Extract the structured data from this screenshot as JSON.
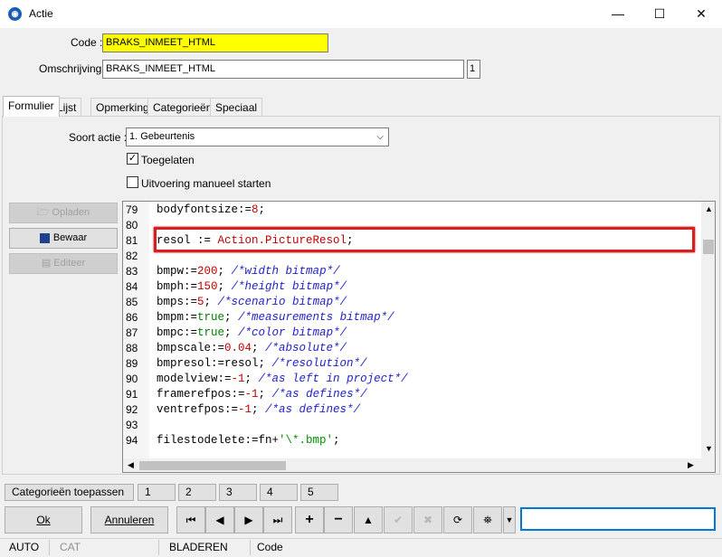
{
  "window": {
    "title": "Actie",
    "app_icon": "app-logo-icon",
    "minimize_icon": "—",
    "maximize_icon": "☐",
    "close_icon": "✕"
  },
  "form": {
    "code_label": "Code :",
    "code_value": "BRAKS_INMEET_HTML",
    "code_bg": "#ffff00",
    "omschrijving_label": "Omschrijving :",
    "omschrijving_value": "BRAKS_INMEET_HTML",
    "omschrijving_suffix": "1"
  },
  "tabs": [
    "Formulier",
    "Lijst",
    "Opmerking",
    "Categorieën",
    "Speciaal"
  ],
  "formulier": {
    "soort_label": "Soort actie :",
    "soort_value": "1.  Gebeurtenis",
    "toegelaten_label": "Toegelaten",
    "toegelaten_checked": true,
    "uitvoering_label": "Uitvoering manueel starten",
    "uitvoering_checked": false
  },
  "side_buttons": {
    "opladen": "Opladen",
    "bewaar": "Bewaar",
    "editeer": "Editeer"
  },
  "code_lines": [
    {
      "n": "79",
      "parts": [
        [
          "kw",
          "bodyfontsize:="
        ],
        [
          "num",
          "8"
        ],
        [
          "kw",
          ";"
        ]
      ]
    },
    {
      "n": "80",
      "parts": []
    },
    {
      "n": "81",
      "parts": [
        [
          "kw",
          "resol := "
        ],
        [
          "num",
          "Action.PictureResol"
        ],
        [
          "kw",
          ";"
        ]
      ]
    },
    {
      "n": "82",
      "parts": []
    },
    {
      "n": "83",
      "parts": [
        [
          "kw",
          "bmpw:="
        ],
        [
          "num",
          "200"
        ],
        [
          "kw",
          "; "
        ],
        [
          "com",
          "/*width bitmap*/"
        ]
      ]
    },
    {
      "n": "84",
      "parts": [
        [
          "kw",
          "bmph:="
        ],
        [
          "num",
          "150"
        ],
        [
          "kw",
          "; "
        ],
        [
          "com",
          "/*height bitmap*/"
        ]
      ]
    },
    {
      "n": "85",
      "parts": [
        [
          "kw",
          "bmps:="
        ],
        [
          "num",
          "5"
        ],
        [
          "kw",
          "; "
        ],
        [
          "com",
          "/*scenario bitmap*/"
        ]
      ]
    },
    {
      "n": "86",
      "parts": [
        [
          "kw",
          "bmpm:="
        ],
        [
          "boolv",
          "true"
        ],
        [
          "kw",
          "; "
        ],
        [
          "com",
          "/*measurements bitmap*/"
        ]
      ]
    },
    {
      "n": "87",
      "parts": [
        [
          "kw",
          "bmpc:="
        ],
        [
          "boolv",
          "true"
        ],
        [
          "kw",
          "; "
        ],
        [
          "com",
          "/*color bitmap*/"
        ]
      ]
    },
    {
      "n": "88",
      "parts": [
        [
          "kw",
          "bmpscale:="
        ],
        [
          "num",
          "0.04"
        ],
        [
          "kw",
          "; "
        ],
        [
          "com",
          "/*absolute*/"
        ]
      ]
    },
    {
      "n": "89",
      "parts": [
        [
          "kw",
          "bmpresol:=resol; "
        ],
        [
          "com",
          "/*resolution*/"
        ]
      ]
    },
    {
      "n": "90",
      "parts": [
        [
          "kw",
          "modelview:="
        ],
        [
          "num",
          "-1"
        ],
        [
          "kw",
          "; "
        ],
        [
          "com",
          "/*as left in project*/"
        ]
      ]
    },
    {
      "n": "91",
      "parts": [
        [
          "kw",
          "framerefpos:="
        ],
        [
          "num",
          "-1"
        ],
        [
          "kw",
          "; "
        ],
        [
          "com",
          "/*as defines*/"
        ]
      ]
    },
    {
      "n": "92",
      "parts": [
        [
          "kw",
          "ventrefpos:="
        ],
        [
          "num",
          "-1"
        ],
        [
          "kw",
          "; "
        ],
        [
          "com",
          "/*as defines*/"
        ]
      ]
    },
    {
      "n": "93",
      "parts": []
    },
    {
      "n": "94",
      "parts": [
        [
          "kw",
          "filestodelete:=fn+"
        ],
        [
          "str",
          "'\\*.bmp'"
        ],
        [
          "kw",
          ";"
        ]
      ]
    }
  ],
  "highlight_color": "#d61f1f",
  "category_bar": {
    "apply_label": "Categorieën toepassen",
    "numbers": [
      "1",
      "2",
      "3",
      "4",
      "5"
    ]
  },
  "bottom": {
    "ok_label": "Ok",
    "annuleren_label": "Annuleren",
    "nav_icons": [
      "first-icon",
      "prev-icon",
      "next-icon",
      "last-icon",
      "add-icon",
      "remove-icon",
      "up-icon",
      "check-icon",
      "cancel-x-icon",
      "refresh-icon",
      "binoculars-icon",
      "dropdown-icon"
    ],
    "search_value": ""
  },
  "status": {
    "auto": "AUTO",
    "cat": "CAT",
    "mode": "BLADEREN",
    "field": "Code"
  }
}
